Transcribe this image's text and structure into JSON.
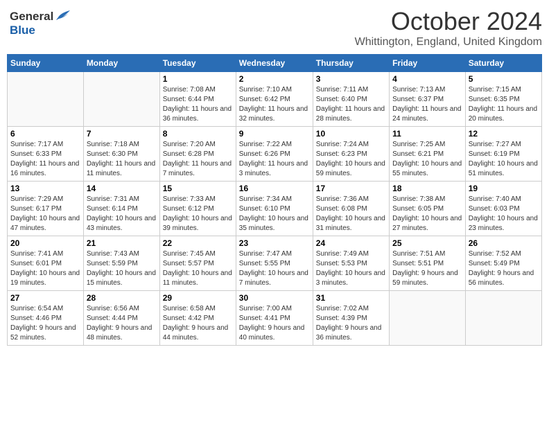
{
  "header": {
    "logo_general": "General",
    "logo_blue": "Blue",
    "month": "October 2024",
    "location": "Whittington, England, United Kingdom"
  },
  "weekdays": [
    "Sunday",
    "Monday",
    "Tuesday",
    "Wednesday",
    "Thursday",
    "Friday",
    "Saturday"
  ],
  "weeks": [
    [
      {
        "day": "",
        "sunrise": "",
        "sunset": "",
        "daylight": ""
      },
      {
        "day": "",
        "sunrise": "",
        "sunset": "",
        "daylight": ""
      },
      {
        "day": "1",
        "sunrise": "Sunrise: 7:08 AM",
        "sunset": "Sunset: 6:44 PM",
        "daylight": "Daylight: 11 hours and 36 minutes."
      },
      {
        "day": "2",
        "sunrise": "Sunrise: 7:10 AM",
        "sunset": "Sunset: 6:42 PM",
        "daylight": "Daylight: 11 hours and 32 minutes."
      },
      {
        "day": "3",
        "sunrise": "Sunrise: 7:11 AM",
        "sunset": "Sunset: 6:40 PM",
        "daylight": "Daylight: 11 hours and 28 minutes."
      },
      {
        "day": "4",
        "sunrise": "Sunrise: 7:13 AM",
        "sunset": "Sunset: 6:37 PM",
        "daylight": "Daylight: 11 hours and 24 minutes."
      },
      {
        "day": "5",
        "sunrise": "Sunrise: 7:15 AM",
        "sunset": "Sunset: 6:35 PM",
        "daylight": "Daylight: 11 hours and 20 minutes."
      }
    ],
    [
      {
        "day": "6",
        "sunrise": "Sunrise: 7:17 AM",
        "sunset": "Sunset: 6:33 PM",
        "daylight": "Daylight: 11 hours and 16 minutes."
      },
      {
        "day": "7",
        "sunrise": "Sunrise: 7:18 AM",
        "sunset": "Sunset: 6:30 PM",
        "daylight": "Daylight: 11 hours and 11 minutes."
      },
      {
        "day": "8",
        "sunrise": "Sunrise: 7:20 AM",
        "sunset": "Sunset: 6:28 PM",
        "daylight": "Daylight: 11 hours and 7 minutes."
      },
      {
        "day": "9",
        "sunrise": "Sunrise: 7:22 AM",
        "sunset": "Sunset: 6:26 PM",
        "daylight": "Daylight: 11 hours and 3 minutes."
      },
      {
        "day": "10",
        "sunrise": "Sunrise: 7:24 AM",
        "sunset": "Sunset: 6:23 PM",
        "daylight": "Daylight: 10 hours and 59 minutes."
      },
      {
        "day": "11",
        "sunrise": "Sunrise: 7:25 AM",
        "sunset": "Sunset: 6:21 PM",
        "daylight": "Daylight: 10 hours and 55 minutes."
      },
      {
        "day": "12",
        "sunrise": "Sunrise: 7:27 AM",
        "sunset": "Sunset: 6:19 PM",
        "daylight": "Daylight: 10 hours and 51 minutes."
      }
    ],
    [
      {
        "day": "13",
        "sunrise": "Sunrise: 7:29 AM",
        "sunset": "Sunset: 6:17 PM",
        "daylight": "Daylight: 10 hours and 47 minutes."
      },
      {
        "day": "14",
        "sunrise": "Sunrise: 7:31 AM",
        "sunset": "Sunset: 6:14 PM",
        "daylight": "Daylight: 10 hours and 43 minutes."
      },
      {
        "day": "15",
        "sunrise": "Sunrise: 7:33 AM",
        "sunset": "Sunset: 6:12 PM",
        "daylight": "Daylight: 10 hours and 39 minutes."
      },
      {
        "day": "16",
        "sunrise": "Sunrise: 7:34 AM",
        "sunset": "Sunset: 6:10 PM",
        "daylight": "Daylight: 10 hours and 35 minutes."
      },
      {
        "day": "17",
        "sunrise": "Sunrise: 7:36 AM",
        "sunset": "Sunset: 6:08 PM",
        "daylight": "Daylight: 10 hours and 31 minutes."
      },
      {
        "day": "18",
        "sunrise": "Sunrise: 7:38 AM",
        "sunset": "Sunset: 6:05 PM",
        "daylight": "Daylight: 10 hours and 27 minutes."
      },
      {
        "day": "19",
        "sunrise": "Sunrise: 7:40 AM",
        "sunset": "Sunset: 6:03 PM",
        "daylight": "Daylight: 10 hours and 23 minutes."
      }
    ],
    [
      {
        "day": "20",
        "sunrise": "Sunrise: 7:41 AM",
        "sunset": "Sunset: 6:01 PM",
        "daylight": "Daylight: 10 hours and 19 minutes."
      },
      {
        "day": "21",
        "sunrise": "Sunrise: 7:43 AM",
        "sunset": "Sunset: 5:59 PM",
        "daylight": "Daylight: 10 hours and 15 minutes."
      },
      {
        "day": "22",
        "sunrise": "Sunrise: 7:45 AM",
        "sunset": "Sunset: 5:57 PM",
        "daylight": "Daylight: 10 hours and 11 minutes."
      },
      {
        "day": "23",
        "sunrise": "Sunrise: 7:47 AM",
        "sunset": "Sunset: 5:55 PM",
        "daylight": "Daylight: 10 hours and 7 minutes."
      },
      {
        "day": "24",
        "sunrise": "Sunrise: 7:49 AM",
        "sunset": "Sunset: 5:53 PM",
        "daylight": "Daylight: 10 hours and 3 minutes."
      },
      {
        "day": "25",
        "sunrise": "Sunrise: 7:51 AM",
        "sunset": "Sunset: 5:51 PM",
        "daylight": "Daylight: 9 hours and 59 minutes."
      },
      {
        "day": "26",
        "sunrise": "Sunrise: 7:52 AM",
        "sunset": "Sunset: 5:49 PM",
        "daylight": "Daylight: 9 hours and 56 minutes."
      }
    ],
    [
      {
        "day": "27",
        "sunrise": "Sunrise: 6:54 AM",
        "sunset": "Sunset: 4:46 PM",
        "daylight": "Daylight: 9 hours and 52 minutes."
      },
      {
        "day": "28",
        "sunrise": "Sunrise: 6:56 AM",
        "sunset": "Sunset: 4:44 PM",
        "daylight": "Daylight: 9 hours and 48 minutes."
      },
      {
        "day": "29",
        "sunrise": "Sunrise: 6:58 AM",
        "sunset": "Sunset: 4:42 PM",
        "daylight": "Daylight: 9 hours and 44 minutes."
      },
      {
        "day": "30",
        "sunrise": "Sunrise: 7:00 AM",
        "sunset": "Sunset: 4:41 PM",
        "daylight": "Daylight: 9 hours and 40 minutes."
      },
      {
        "day": "31",
        "sunrise": "Sunrise: 7:02 AM",
        "sunset": "Sunset: 4:39 PM",
        "daylight": "Daylight: 9 hours and 36 minutes."
      },
      {
        "day": "",
        "sunrise": "",
        "sunset": "",
        "daylight": ""
      },
      {
        "day": "",
        "sunrise": "",
        "sunset": "",
        "daylight": ""
      }
    ]
  ]
}
